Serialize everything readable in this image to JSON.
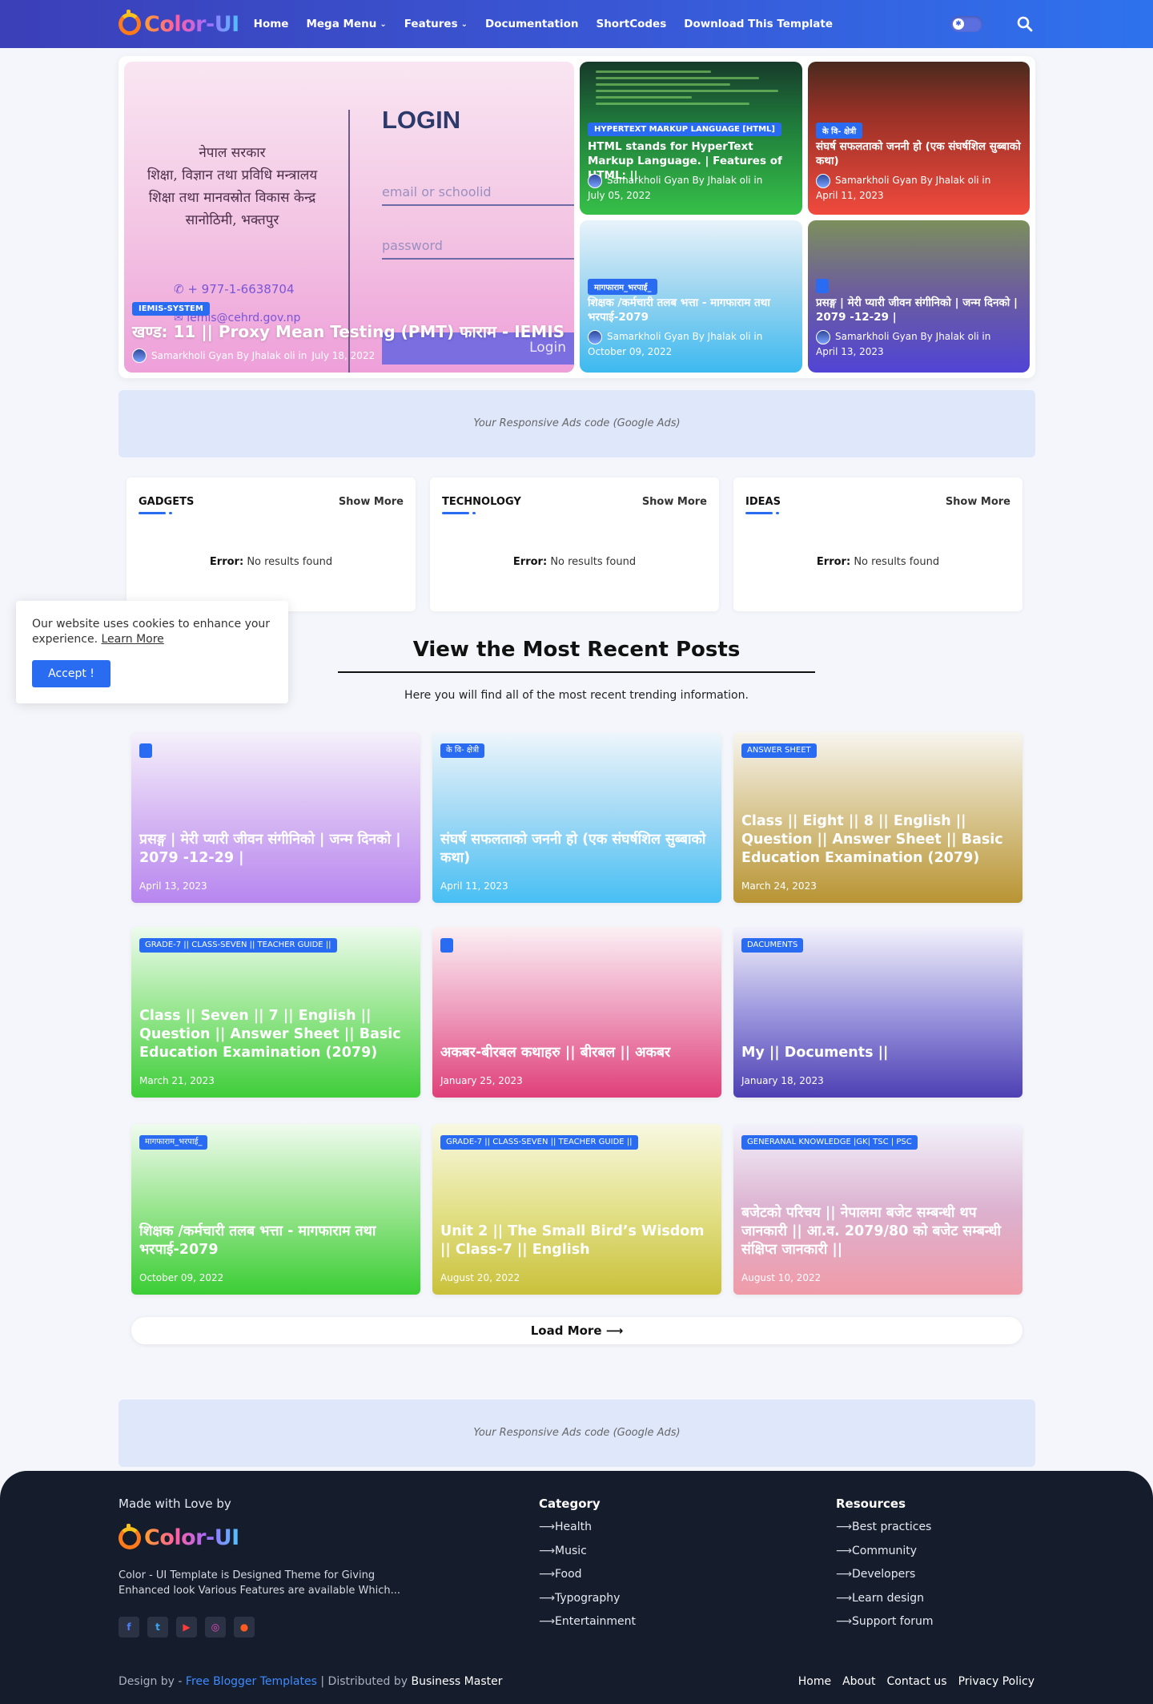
{
  "header": {
    "logo_text": "Color-UI",
    "nav": [
      {
        "label": "Home",
        "dropdown": false
      },
      {
        "label": "Mega Menu",
        "dropdown": true
      },
      {
        "label": "Features",
        "dropdown": true
      },
      {
        "label": "Documentation",
        "dropdown": false
      },
      {
        "label": "ShortCodes",
        "dropdown": false
      },
      {
        "label": "Download This Template",
        "dropdown": false
      }
    ],
    "toggle_icon": "sun-icon",
    "search_icon": "search-icon"
  },
  "hero": {
    "main": {
      "image_text": {
        "nepal_lines": [
          "नेपाल सरकार",
          "शिक्षा, विज्ञान तथा प्रविधि मन्त्रालय",
          "शिक्षा तथा मानवस्रोत विकास केन्द्र",
          "सानोठिमी, भक्तपुर"
        ],
        "login": "LOGIN",
        "email_placeholder": "email or schoolid",
        "password_placeholder": "password",
        "phone": "+ 977-1-6638704",
        "email": "iemis@cehrd.gov.np",
        "login_button": "Login"
      },
      "label": "IEMIS-SYSTEM",
      "title": "खण्ड: 11 || Proxy Mean Testing (PMT) फाराम - IEMIS",
      "author": "Samarkholi Gyan By Jhalak oli in",
      "date": "July 18, 2022"
    },
    "cards": [
      {
        "label": "HYPERTEXT MARKUP LANGUAGE [HTML]",
        "title": "HTML stands for HyperText Markup Language. | Features of HTML: ||",
        "author": "Samarkholi Gyan By Jhalak oli in",
        "date": "July 05, 2022"
      },
      {
        "label": "के वि- क्षेत्री",
        "title": "संघर्ष सफलताको जननी हो (एक संघर्षशिल सुब्बाको कथा)",
        "author": "Samarkholi Gyan By Jhalak oli in",
        "date": "April 11, 2023"
      },
      {
        "label": "मागफाराम_भरपाई_",
        "title": "शिक्षक /कर्मचारी तलब भत्ता - मागफाराम तथा भरपाई-2079",
        "author": "Samarkholi Gyan By Jhalak oli in",
        "date": "October 09, 2022"
      },
      {
        "label": "",
        "title": "प्रसङ्ग | मेरी प्यारी जीवन संगीनिको | जन्म दिनको | 2079 -12-29 |",
        "author": "Samarkholi Gyan By Jhalak oli in",
        "date": "April 13, 2023"
      }
    ]
  },
  "ads": {
    "text": "Your Responsive Ads code (Google Ads)"
  },
  "widgets": [
    {
      "title": "GADGETS",
      "more": "Show More",
      "error_label": "Error:",
      "error_text": "No results found"
    },
    {
      "title": "TECHNOLOGY",
      "more": "Show More",
      "error_label": "Error:",
      "error_text": "No results found"
    },
    {
      "title": "IDEAS",
      "more": "Show More",
      "error_label": "Error:",
      "error_text": "No results found"
    }
  ],
  "cookie": {
    "text": "Our website uses cookies to enhance your experience.",
    "link": "Learn More",
    "button": "Accept !"
  },
  "recent": {
    "title": "View the Most Recent Posts",
    "subtitle": "Here you will find all of the most recent trending information.",
    "posts": [
      {
        "label": "",
        "title": "प्रसङ्ग | मेरी प्यारी जीवन संगीनिको | जन्म दिनको | 2079 -12-29 |",
        "date": "April 13, 2023"
      },
      {
        "label": "के वि- क्षेत्री",
        "title": "संघर्ष सफलताको जननी हो (एक संघर्षशिल सुब्बाको कथा)",
        "date": "April 11, 2023"
      },
      {
        "label": "ANSWER SHEET",
        "title": "Class || Eight || 8 || English || Question || Answer Sheet || Basic Education Examination (2079)",
        "date": "March 24, 2023"
      },
      {
        "label": "GRADE-7 || CLASS-SEVEN || TEACHER GUIDE ||",
        "title": "Class || Seven || 7 || English || Question || Answer Sheet || Basic Education Examination (2079)",
        "date": "March 21, 2023"
      },
      {
        "label": "",
        "title": "अकबर-बीरबल कथाहरु || बीरबल || अकबर",
        "date": "January 25, 2023"
      },
      {
        "label": "DACUMENTS",
        "title": "My || Documents ||",
        "date": "January 18, 2023"
      },
      {
        "label": "मागफाराम_भरपाई_",
        "title": "शिक्षक /कर्मचारी तलब भत्ता - मागफाराम तथा भरपाई-2079",
        "date": "October 09, 2022"
      },
      {
        "label": "GRADE-7 || CLASS-SEVEN || TEACHER GUIDE ||",
        "title": "Unit 2 || The Small Bird’s Wisdom || Class-7 || English",
        "date": "August 20, 2022"
      },
      {
        "label": "GENERANAL KNOWLEDGE |GK| TSC | PSC",
        "title": "बजेटको परिचय || नेपालमा बजेट सम्बन्धी थप जानकारी || आ.व. 2079/80 को बजेट सम्बन्धी संक्षिप्त जानकारी ||",
        "date": "August 10, 2022"
      }
    ],
    "load_more": "Load More ⟶"
  },
  "footer": {
    "made_with": "Made with Love by",
    "logo_text": "Color-UI",
    "description": "Color - UI Template is Designed Theme for Giving Enhanced look Various Features are available Which...",
    "socials": [
      "facebook-icon",
      "twitter-icon",
      "youtube-icon",
      "instagram-icon",
      "reddit-icon"
    ],
    "category": {
      "title": "Category",
      "items": [
        "Health",
        "Music",
        "Food",
        "Typography",
        "Entertainment"
      ]
    },
    "resources": {
      "title": "Resources",
      "items": [
        "Best practices",
        "Community",
        "Developers",
        "Learn design",
        "Support forum"
      ]
    },
    "design_by": "Design by - ",
    "design_link": "Free Blogger Templates",
    "distributed_by": " | Distributed by ",
    "distributed_link": "Business Master",
    "links": [
      "Home",
      "About",
      "Contact us",
      "Privacy Policy"
    ]
  }
}
